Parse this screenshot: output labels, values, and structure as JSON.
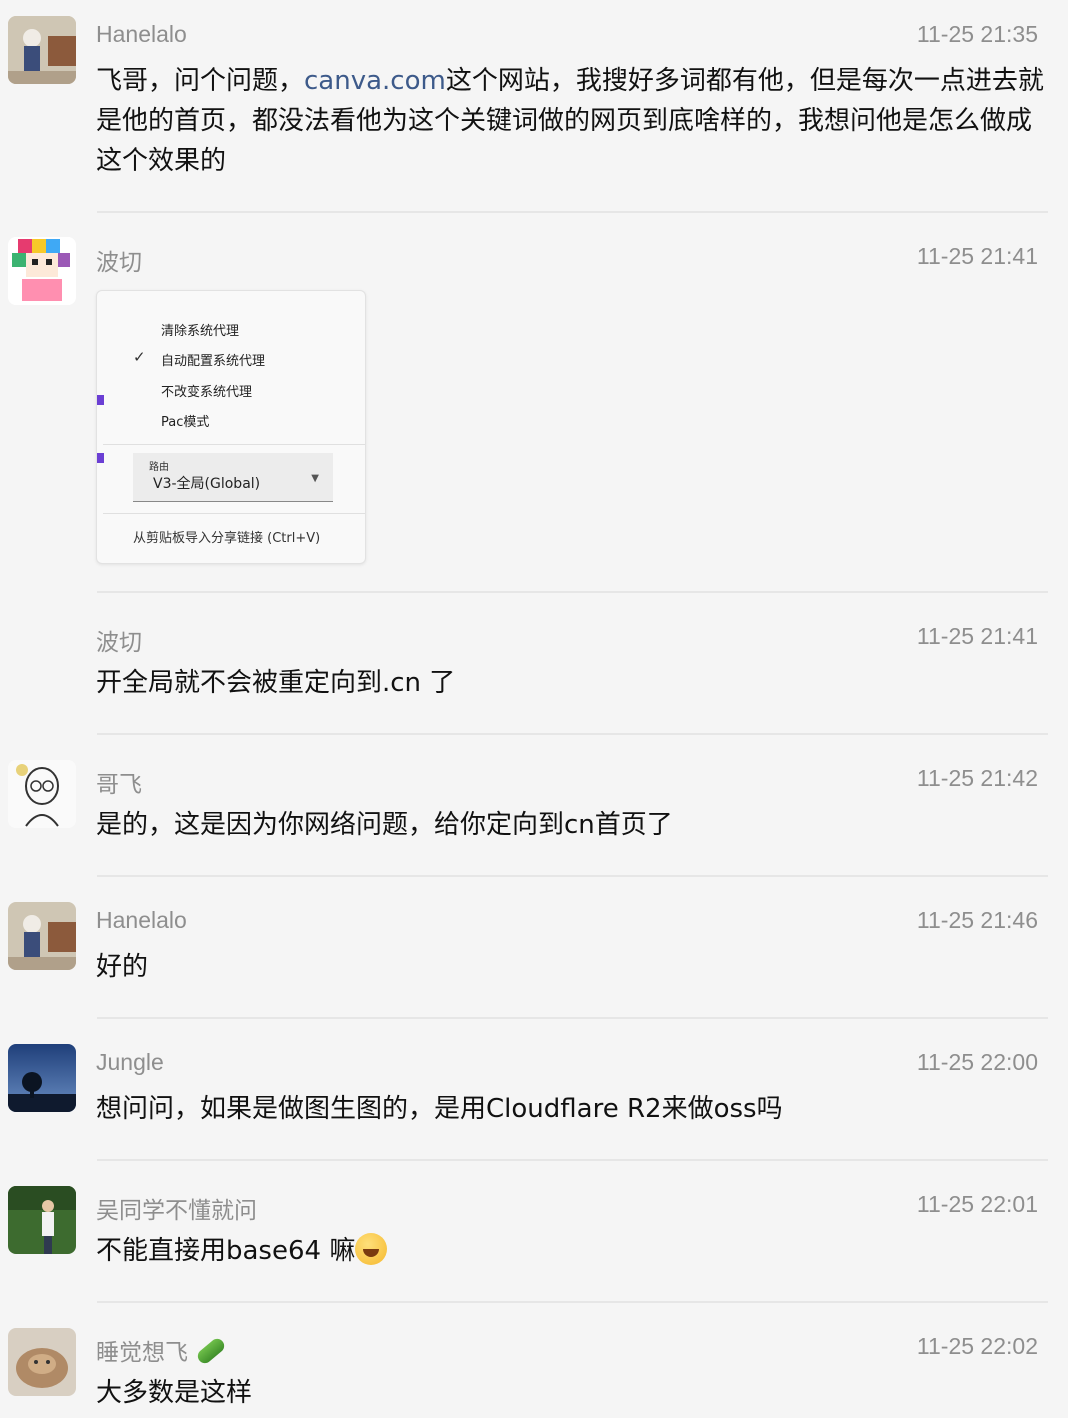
{
  "messages": [
    {
      "name": "Hanelalo",
      "time": "11-25 21:35",
      "text_link": "canva.com",
      "text_before": "飞哥，问个问题，",
      "text_after": "这个网站，我搜好多词都有他，但是每次一点进去就是他的首页，都没法看他为这个关键词做的网页到底啥样的，我想问他是怎么做成这个效果的"
    },
    {
      "name": "波切",
      "time": "11-25 21:41"
    },
    {
      "name": "波切",
      "time": "11-25 21:41",
      "text": "开全局就不会被重定向到.cn 了"
    },
    {
      "name": "哥飞",
      "time": "11-25 21:42",
      "text": "是的，这是因为你网络问题，给你定向到cn首页了"
    },
    {
      "name": "Hanelalo",
      "time": "11-25 21:46",
      "text": "好的"
    },
    {
      "name": "Jungle",
      "time": "11-25 22:00",
      "text": "想问问，如果是做图生图的，是用Cloudflare R2来做oss吗"
    },
    {
      "name": "吴同学不懂就问",
      "time": "11-25 22:01",
      "text": "不能直接用base64 嘛"
    },
    {
      "name": "睡觉想飞",
      "time": "11-25 22:02",
      "text": "大多数是这样"
    }
  ],
  "proxy_menu": {
    "items": [
      "清除系统代理",
      "自动配置系统代理",
      "不改变系统代理",
      "Pac模式"
    ],
    "checked_index": 1,
    "route_label": "路由",
    "route_value": "V3-全局(Global)",
    "import_label": "从剪贴板导入分享链接 (Ctrl+V)"
  },
  "icons": [
    "checkmark-icon",
    "dropdown-caret-icon",
    "laughing-emoji-icon",
    "cucumber-emoji-icon"
  ]
}
